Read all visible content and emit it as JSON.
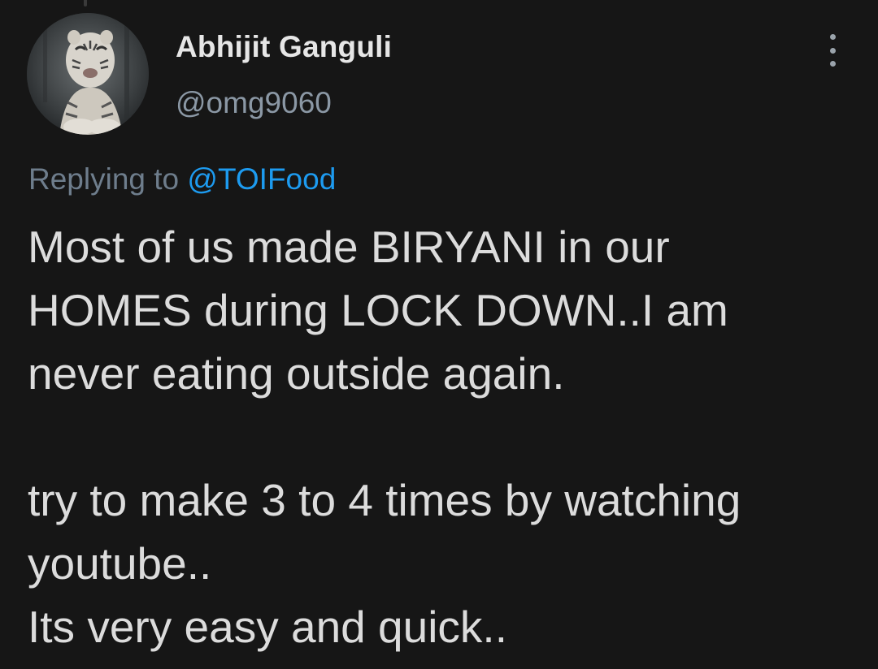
{
  "tweet": {
    "author_name": "Abhijit Ganguli",
    "author_handle": "@omg9060",
    "avatar_icon": "tiger-avatar",
    "reply_prefix": "Replying to",
    "reply_mention": "@TOIFood",
    "paragraph_1": "Most of us made BIRYANI in our\nHOMES during LOCK DOWN..I am\nnever eating outside again.",
    "paragraph_2": "try to make 3 to 4 times by watching\nyoutube..\nIts very easy and quick..",
    "more_icon": "more-vertical-icon"
  },
  "colors": {
    "background": "#161616",
    "text": "#dcdcdc",
    "muted": "#8b98a5",
    "link": "#1d9bf0"
  }
}
